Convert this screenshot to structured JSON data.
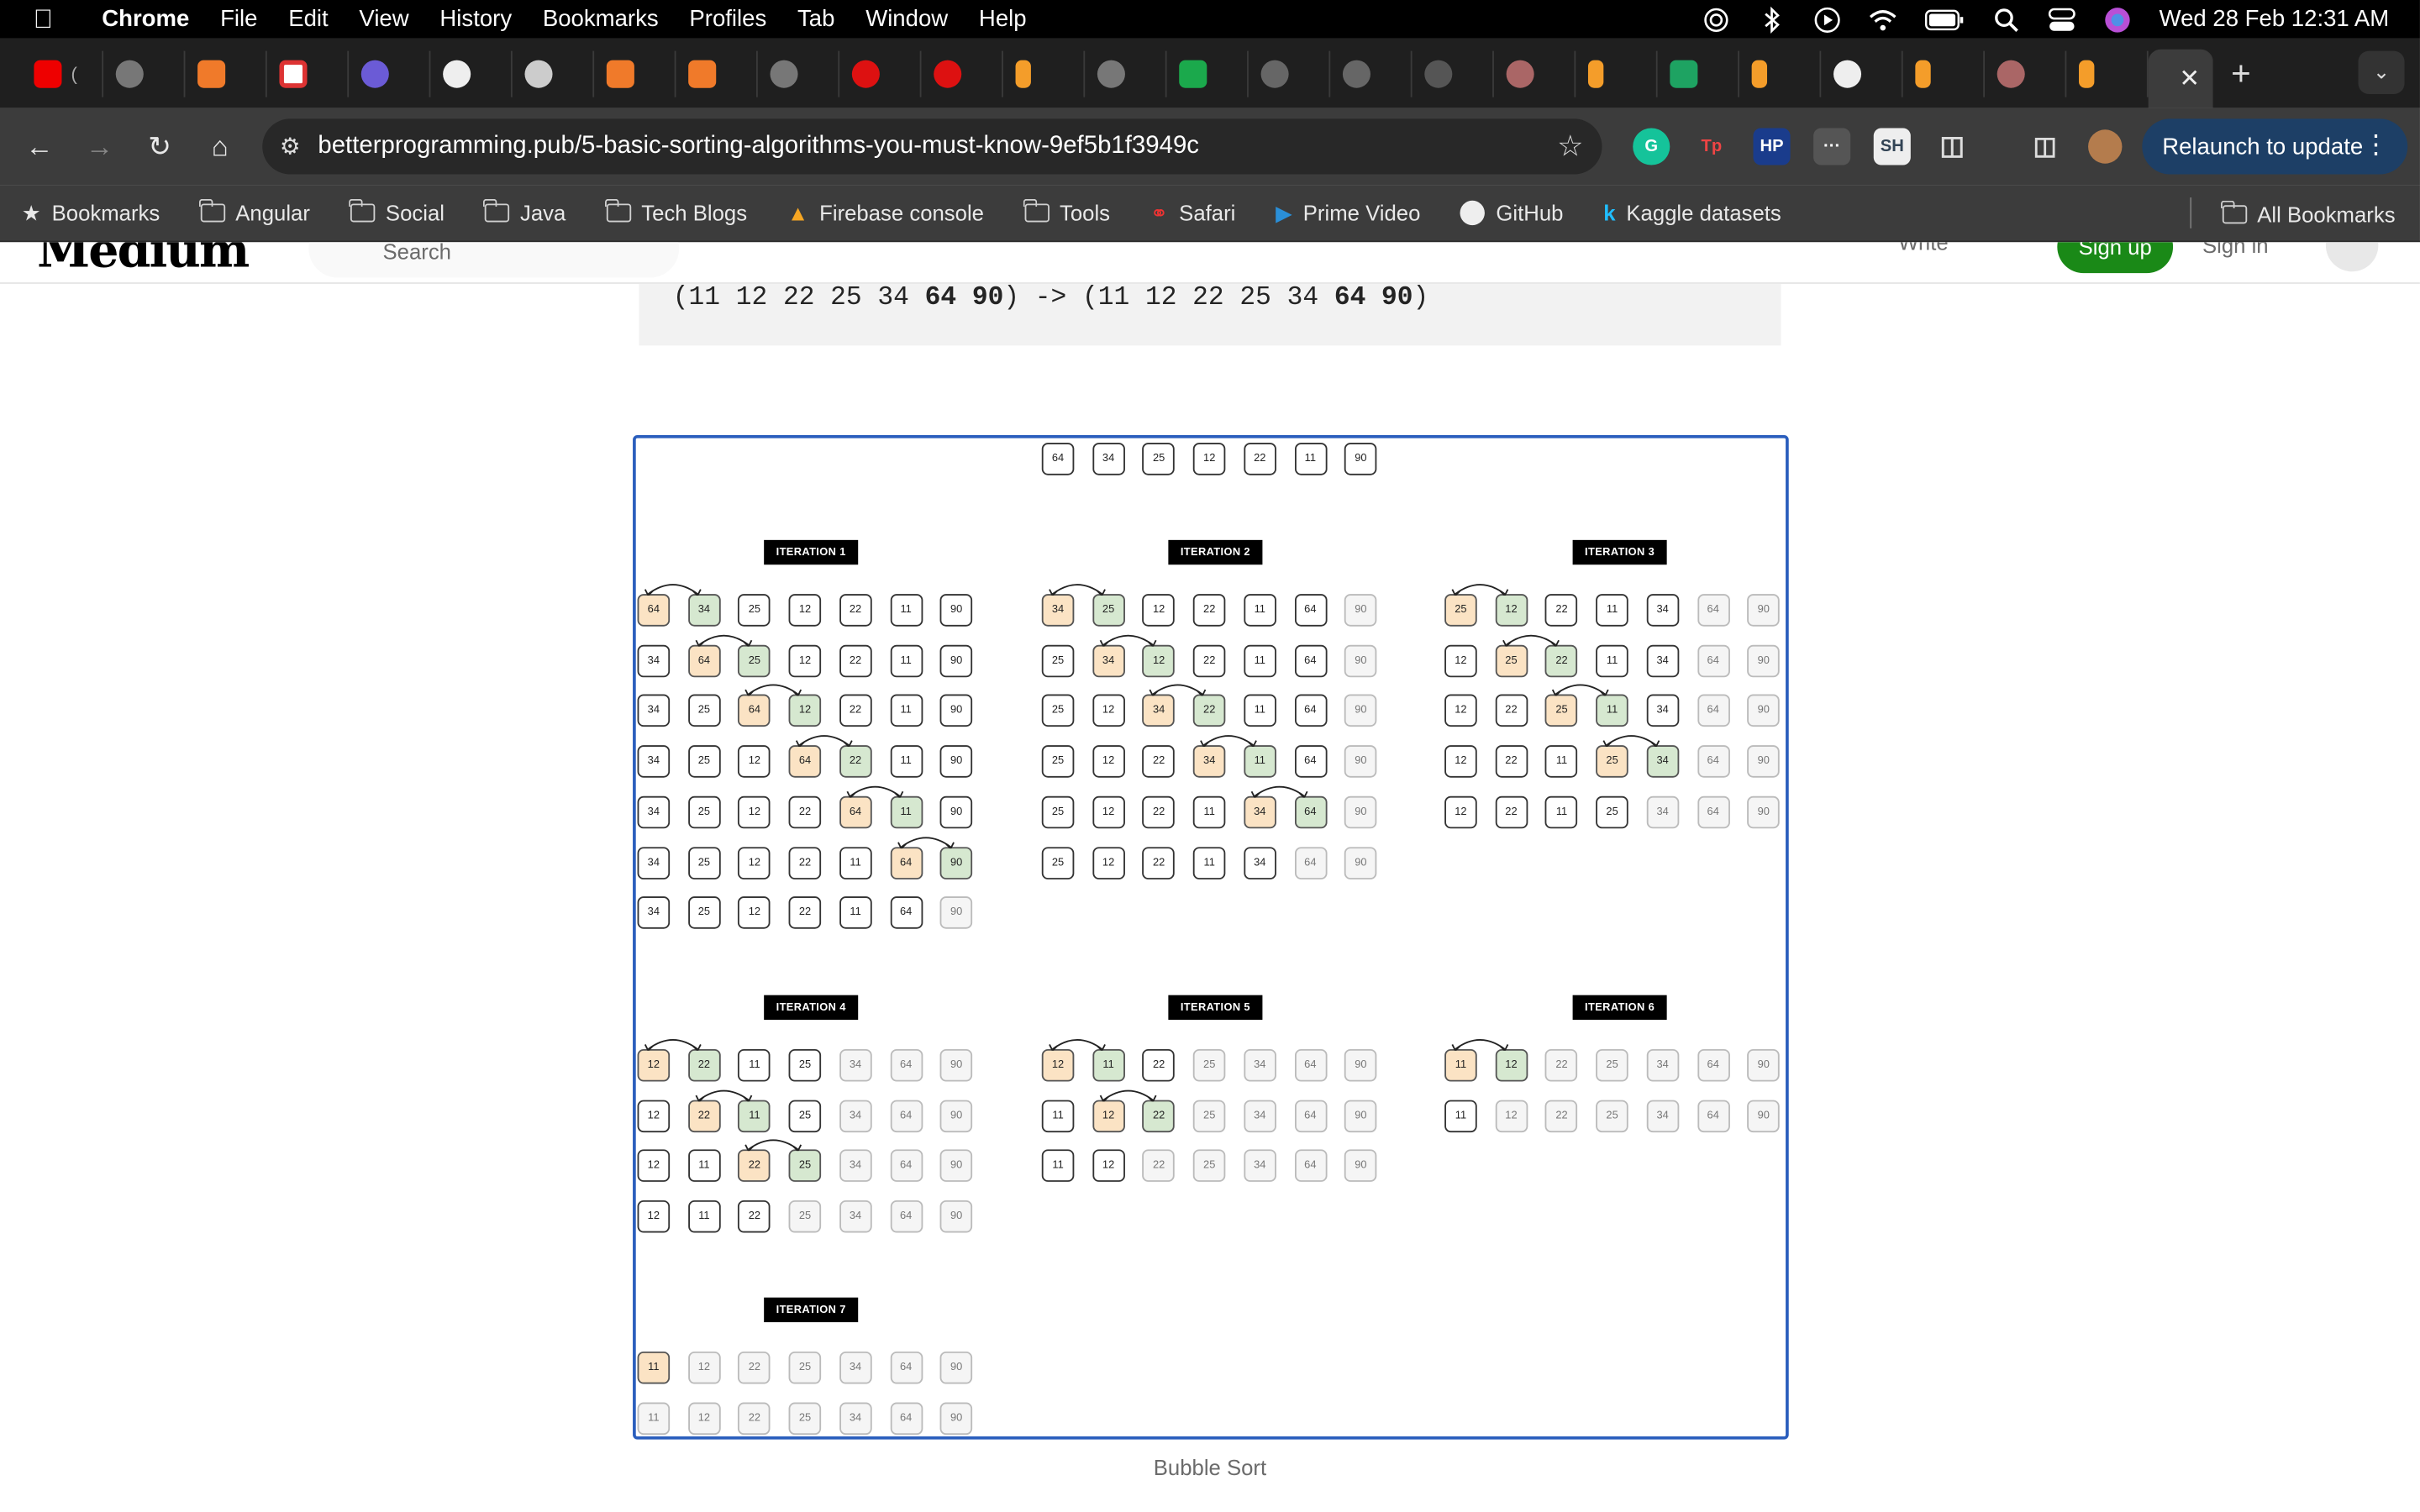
{
  "menubar": {
    "app": "Chrome",
    "items": [
      "File",
      "Edit",
      "View",
      "History",
      "Bookmarks",
      "Profiles",
      "Tab",
      "Window",
      "Help"
    ],
    "clock": "Wed 28 Feb  12:31 AM"
  },
  "toolbar": {
    "url_host": "betterprogramming.pub",
    "url_path": "/5-basic-sorting-algorithms-you-must-know-9ef5b1f3949c",
    "relaunch_label": "Relaunch to update"
  },
  "bookmarks": {
    "items": [
      "Bookmarks",
      "Angular",
      "Social",
      "Java",
      "Tech Blogs",
      "Firebase console",
      "Tools",
      "Safari",
      "Prime Video",
      "GitHub",
      "Kaggle datasets"
    ],
    "all": "All Bookmarks"
  },
  "medium": {
    "logo": "Medium",
    "search_placeholder": "Search",
    "write": "Write",
    "signup": "Sign up",
    "signin": "Sign in"
  },
  "code": {
    "pre": "(11 12 22 25 34 ",
    "bold1": "64 90",
    "mid": ") -> (11 12 22 25 34 ",
    "bold2": "64 90",
    "post": ")"
  },
  "figure": {
    "initial": [
      "64",
      "34",
      "25",
      "12",
      "22",
      "11",
      "90"
    ],
    "iterations": [
      {
        "label": "ITERATION 1",
        "rows": [
          {
            "v": [
              "64",
              "34",
              "25",
              "12",
              "22",
              "11",
              "90"
            ],
            "swap": 0,
            "sorted": 0
          },
          {
            "v": [
              "34",
              "64",
              "25",
              "12",
              "22",
              "11",
              "90"
            ],
            "swap": 1,
            "sorted": 0
          },
          {
            "v": [
              "34",
              "25",
              "64",
              "12",
              "22",
              "11",
              "90"
            ],
            "swap": 2,
            "sorted": 0
          },
          {
            "v": [
              "34",
              "25",
              "12",
              "64",
              "22",
              "11",
              "90"
            ],
            "swap": 3,
            "sorted": 0
          },
          {
            "v": [
              "34",
              "25",
              "12",
              "22",
              "64",
              "11",
              "90"
            ],
            "swap": 4,
            "sorted": 0
          },
          {
            "v": [
              "34",
              "25",
              "12",
              "22",
              "11",
              "64",
              "90"
            ],
            "swap": 5,
            "sorted": 0
          },
          {
            "v": [
              "34",
              "25",
              "12",
              "22",
              "11",
              "64",
              "90"
            ],
            "swap": -1,
            "sorted": 1
          }
        ]
      },
      {
        "label": "ITERATION 2",
        "rows": [
          {
            "v": [
              "34",
              "25",
              "12",
              "22",
              "11",
              "64",
              "90"
            ],
            "swap": 0,
            "sorted": 1
          },
          {
            "v": [
              "25",
              "34",
              "12",
              "22",
              "11",
              "64",
              "90"
            ],
            "swap": 1,
            "sorted": 1
          },
          {
            "v": [
              "25",
              "12",
              "34",
              "22",
              "11",
              "64",
              "90"
            ],
            "swap": 2,
            "sorted": 1
          },
          {
            "v": [
              "25",
              "12",
              "22",
              "34",
              "11",
              "64",
              "90"
            ],
            "swap": 3,
            "sorted": 1
          },
          {
            "v": [
              "25",
              "12",
              "22",
              "11",
              "34",
              "64",
              "90"
            ],
            "swap": 4,
            "sorted": 1
          },
          {
            "v": [
              "25",
              "12",
              "22",
              "11",
              "34",
              "64",
              "90"
            ],
            "swap": -1,
            "sorted": 2
          }
        ]
      },
      {
        "label": "ITERATION 3",
        "rows": [
          {
            "v": [
              "25",
              "12",
              "22",
              "11",
              "34",
              "64",
              "90"
            ],
            "swap": 0,
            "sorted": 2
          },
          {
            "v": [
              "12",
              "25",
              "22",
              "11",
              "34",
              "64",
              "90"
            ],
            "swap": 1,
            "sorted": 2
          },
          {
            "v": [
              "12",
              "22",
              "25",
              "11",
              "34",
              "64",
              "90"
            ],
            "swap": 2,
            "sorted": 2
          },
          {
            "v": [
              "12",
              "22",
              "11",
              "25",
              "34",
              "64",
              "90"
            ],
            "swap": 3,
            "sorted": 2
          },
          {
            "v": [
              "12",
              "22",
              "11",
              "25",
              "34",
              "64",
              "90"
            ],
            "swap": -1,
            "sorted": 3
          }
        ]
      },
      {
        "label": "ITERATION 4",
        "rows": [
          {
            "v": [
              "12",
              "22",
              "11",
              "25",
              "34",
              "64",
              "90"
            ],
            "swap": 0,
            "sorted": 3
          },
          {
            "v": [
              "12",
              "22",
              "11",
              "25",
              "34",
              "64",
              "90"
            ],
            "swap": 1,
            "sorted": 3
          },
          {
            "v": [
              "12",
              "11",
              "22",
              "25",
              "34",
              "64",
              "90"
            ],
            "swap": 2,
            "sorted": 3
          },
          {
            "v": [
              "12",
              "11",
              "22",
              "25",
              "34",
              "64",
              "90"
            ],
            "swap": -1,
            "sorted": 4
          }
        ]
      },
      {
        "label": "ITERATION 5",
        "rows": [
          {
            "v": [
              "12",
              "11",
              "22",
              "25",
              "34",
              "64",
              "90"
            ],
            "swap": 0,
            "sorted": 4
          },
          {
            "v": [
              "11",
              "12",
              "22",
              "25",
              "34",
              "64",
              "90"
            ],
            "swap": 1,
            "sorted": 4
          },
          {
            "v": [
              "11",
              "12",
              "22",
              "25",
              "34",
              "64",
              "90"
            ],
            "swap": -1,
            "sorted": 5
          }
        ]
      },
      {
        "label": "ITERATION 6",
        "rows": [
          {
            "v": [
              "11",
              "12",
              "22",
              "25",
              "34",
              "64",
              "90"
            ],
            "swap": 0,
            "sorted": 5
          },
          {
            "v": [
              "11",
              "12",
              "22",
              "25",
              "34",
              "64",
              "90"
            ],
            "swap": -1,
            "sorted": 6
          }
        ]
      },
      {
        "label": "ITERATION 7",
        "rows": [
          {
            "v": [
              "11",
              "12",
              "22",
              "25",
              "34",
              "64",
              "90"
            ],
            "swap": -2,
            "sorted": 6
          },
          {
            "v": [
              "11",
              "12",
              "22",
              "25",
              "34",
              "64",
              "90"
            ],
            "swap": -1,
            "sorted": 7
          }
        ]
      }
    ],
    "caption": "Bubble Sort"
  },
  "colors": {
    "swap_left": "#fbe3c4",
    "swap_right": "#d6e8d0",
    "figure_border": "#2a5ebd",
    "signup": "#1a8917"
  }
}
